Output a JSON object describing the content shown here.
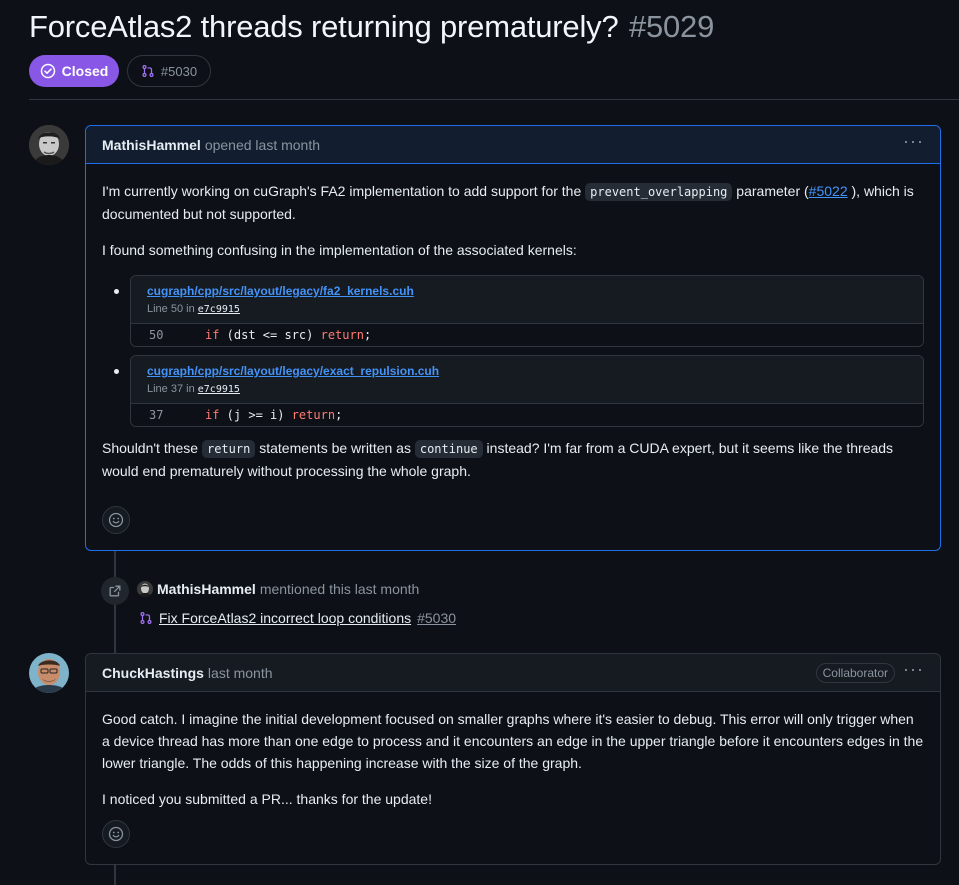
{
  "issue": {
    "title": "ForceAtlas2 threads returning prematurely?",
    "number": "#5029",
    "state": "Closed",
    "linked_pr": "#5030"
  },
  "comments": [
    {
      "author": "MathisHammel",
      "meta": "opened last month",
      "p1_pre": "I'm currently working on cuGraph's FA2 implementation to add support for the ",
      "p1_code": "prevent_overlapping",
      "p1_mid": " parameter (",
      "p1_link": "#5022",
      "p1_post": " ), which is documented but not supported.",
      "p2": "I found something confusing in the implementation of the associated kernels:",
      "snippets": [
        {
          "path": "cugraph/cpp/src/layout/legacy/fa2_kernels.cuh",
          "line_label": "Line 50 in ",
          "commit": "e7c9915",
          "line_no": "50",
          "kw1": "if",
          "code_mid": " (dst <= src) ",
          "kw2": "return",
          "code_end": ";"
        },
        {
          "path": "cugraph/cpp/src/layout/legacy/exact_repulsion.cuh",
          "line_label": "Line 37 in ",
          "commit": "e7c9915",
          "line_no": "37",
          "kw1": "if",
          "code_mid": " (j >= i) ",
          "kw2": "return",
          "code_end": ";"
        }
      ],
      "p3_pre": "Shouldn't these ",
      "p3_code1": "return",
      "p3_mid": " statements be written as ",
      "p3_code2": "continue",
      "p3_post": " instead? I'm far from a CUDA expert, but it seems like the threads would end prematurely without processing the whole graph."
    },
    {
      "author": "ChuckHastings",
      "meta": "last month",
      "role": "Collaborator",
      "p1": "Good catch. I imagine the initial development focused on smaller graphs where it's easier to debug. This error will only trigger when a device thread has more than one edge to process and it encounters an edge in the upper triangle before it encounters edges in the lower triangle. The odds of this happening increase with the size of the graph.",
      "p2": "I noticed you submitted a PR... thanks for the update!"
    }
  ],
  "event": {
    "author": "MathisHammel",
    "meta": "mentioned this last month",
    "pr_title": "Fix ForceAtlas2 incorrect loop conditions",
    "pr_number": "#5030"
  },
  "icons": {
    "state": "check-circle-icon",
    "pr": "git-pull-request-icon",
    "reaction": "smiley-icon",
    "cross_ref": "link-external-icon",
    "kebab": "kebab-horizontal-icon"
  },
  "colors": {
    "closed_badge": "#8957e5",
    "link": "#4493f8",
    "keyword": "#ff7b72",
    "background": "#0d1117",
    "border": "#30363d",
    "focus_border": "#1f6feb"
  }
}
